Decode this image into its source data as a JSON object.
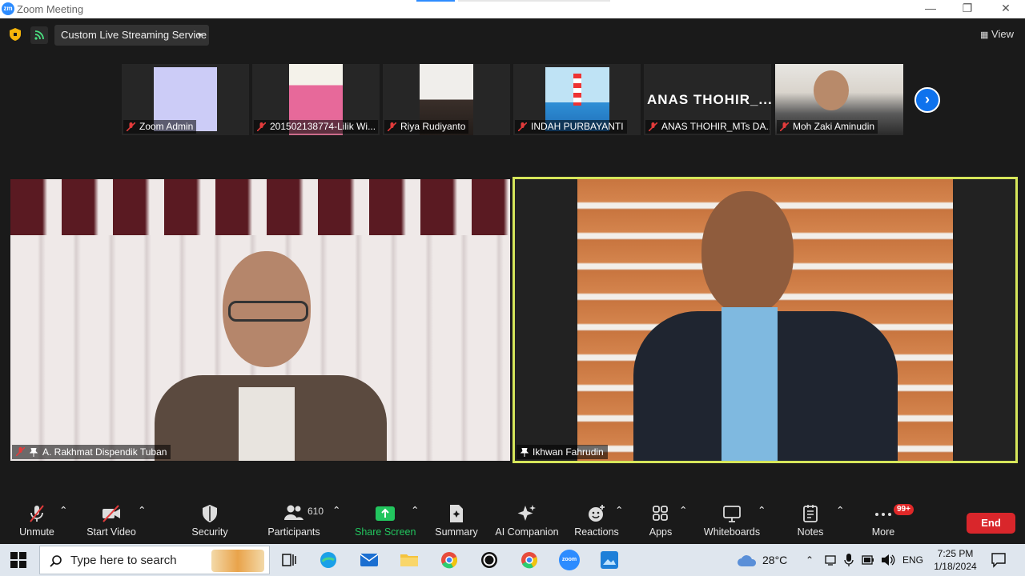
{
  "window": {
    "title": "Zoom Meeting",
    "app_icon": "zm",
    "controls": [
      "minimize-icon",
      "maximize-icon",
      "close-icon"
    ]
  },
  "topbar": {
    "stream_label": "Custom Live Streaming Service",
    "view_label": "View"
  },
  "thumbnails": [
    {
      "name": "Zoom Admin",
      "muted": true
    },
    {
      "name": "201502138774-Lilik Wi...",
      "muted": true
    },
    {
      "name": "Riya Rudiyanto",
      "muted": true
    },
    {
      "name": "INDAH PURBAYANTI",
      "muted": true
    },
    {
      "name": "ANAS THOHIR_MTs DA...",
      "muted": true,
      "display_name": "ANAS  THOHIR_..."
    },
    {
      "name": "Moh Zaki Aminudin",
      "muted": true
    }
  ],
  "main_tiles": [
    {
      "name": "A. Rakhmat Dispendik Tuban",
      "muted": true,
      "pinned": true
    },
    {
      "name": "Ikhwan Fahrudin",
      "muted": false,
      "pinned": true,
      "active_speaker": true
    }
  ],
  "toolbar": {
    "unmute": "Unmute",
    "start_video": "Start Video",
    "security": "Security",
    "participants": "Participants",
    "participants_count": "610",
    "share_screen": "Share Screen",
    "summary": "Summary",
    "ai_companion": "AI Companion",
    "reactions": "Reactions",
    "apps": "Apps",
    "whiteboards": "Whiteboards",
    "notes": "Notes",
    "more": "More",
    "more_badge": "99+",
    "end": "End"
  },
  "taskbar": {
    "search_placeholder": "Type here to search",
    "weather": "28°C",
    "lang": "ENG",
    "time": "7:25 PM",
    "date": "1/18/2024"
  },
  "colors": {
    "zoom_blue": "#2d8cff",
    "active_speaker_border": "#d6e65a",
    "end_red": "#d9262b",
    "share_green": "#22c55e",
    "muted_red": "#e23b3b"
  }
}
